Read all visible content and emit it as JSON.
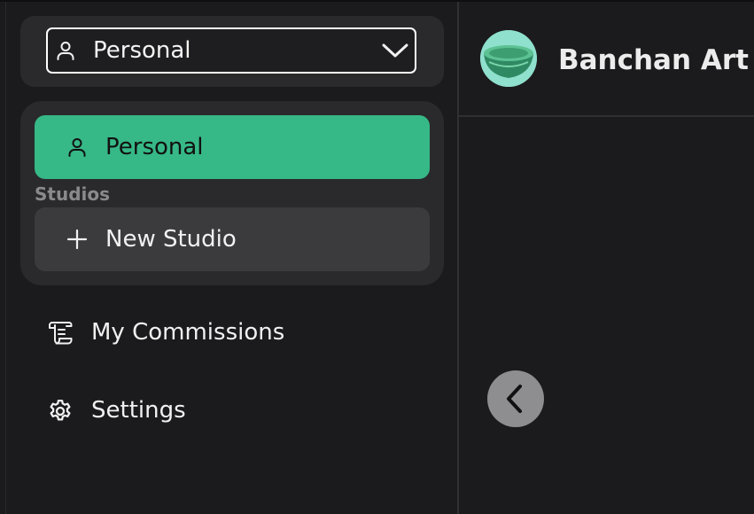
{
  "org_switcher": {
    "selected": "Personal",
    "person_icon": "person-icon",
    "chevron_icon": "chevron-down-icon",
    "border_color": "#ffffff"
  },
  "studios_menu": {
    "personal_label": "Personal",
    "personal_color": "#36b887",
    "studios_heading": "Studios",
    "new_studio_label": "New Studio"
  },
  "nav": [
    {
      "label": "My Commissions",
      "icon": "scroll-icon"
    },
    {
      "label": "Settings",
      "icon": "gear-icon"
    }
  ],
  "brand": {
    "name": "Banchan Art",
    "logo": "banchan-bowl-logo"
  },
  "collapse_button": {
    "icon": "chevron-left-icon"
  }
}
